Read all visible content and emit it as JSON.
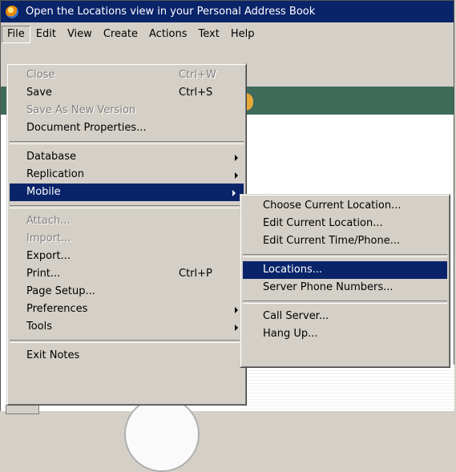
{
  "window": {
    "title": "Open the Locations view in your Personal Address Book"
  },
  "menubar": {
    "items": [
      "File",
      "Edit",
      "View",
      "Create",
      "Actions",
      "Text",
      "Help"
    ]
  },
  "file_menu": {
    "close": {
      "label": "Close",
      "shortcut": "Ctrl+W"
    },
    "save": {
      "label": "Save",
      "shortcut": "Ctrl+S"
    },
    "save_as_new_version": {
      "label": "Save As New Version"
    },
    "document_properties": {
      "label": "Document Properties..."
    },
    "database": {
      "label": "Database"
    },
    "replication": {
      "label": "Replication"
    },
    "mobile": {
      "label": "Mobile"
    },
    "attach": {
      "label": "Attach..."
    },
    "import": {
      "label": "Import..."
    },
    "export": {
      "label": "Export..."
    },
    "print": {
      "label": "Print...",
      "shortcut": "Ctrl+P"
    },
    "page_setup": {
      "label": "Page Setup..."
    },
    "preferences": {
      "label": "Preferences"
    },
    "tools": {
      "label": "Tools"
    },
    "exit_notes": {
      "label": "Exit Notes"
    }
  },
  "mobile_menu": {
    "choose_current_location": "Choose Current Location...",
    "edit_current_location": "Edit Current Location...",
    "edit_current_time_phone": "Edit Current Time/Phone...",
    "locations": "Locations...",
    "server_phone_numbers": "Server Phone Numbers...",
    "call_server": "Call Server...",
    "hang_up": "Hang Up..."
  },
  "colors": {
    "title_bar": "#0a246a",
    "selection": "#0a246a",
    "menu_bg": "#d4d0c8"
  },
  "icons": {
    "app_icon": "lotus-notes-icon",
    "submenu_arrow": "chevron-right-icon"
  }
}
